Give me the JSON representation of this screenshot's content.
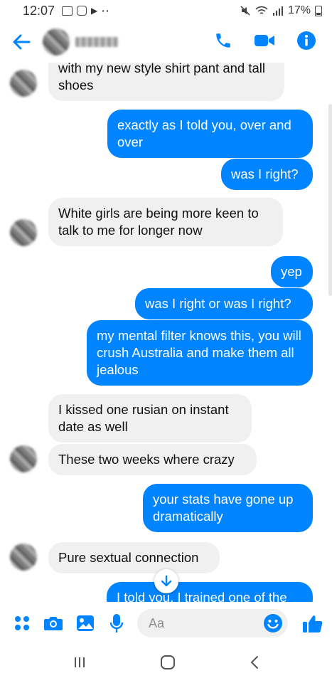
{
  "status_bar": {
    "time": "12:07",
    "battery": "17%"
  },
  "header": {
    "contact_name": ""
  },
  "messages": [
    {
      "dir": "in",
      "text": "with my new style shirt pant and tall shoes"
    },
    {
      "dir": "out",
      "text": "exactly as I told you, over and over"
    },
    {
      "dir": "out",
      "text": "was I right?"
    },
    {
      "dir": "in",
      "text": "White girls are being more keen to talk to me for longer now"
    },
    {
      "dir": "out",
      "text": "yep"
    },
    {
      "dir": "out",
      "text": "was I right or was I right?"
    },
    {
      "dir": "out",
      "text": "my mental filter knows this, you will crush Australia and make them all jealous"
    },
    {
      "dir": "in",
      "text": "I kissed one rusian on instant date as well"
    },
    {
      "dir": "in",
      "text": "These two weeks where crazy"
    },
    {
      "dir": "out",
      "text": "your stats have gone up dramatically"
    },
    {
      "dir": "in",
      "text": "Pure sextual connection"
    },
    {
      "dir": "out",
      "text": "I told you, I trained one of the"
    }
  ],
  "composer": {
    "placeholder": "Aa"
  },
  "colors": {
    "accent": "#0084ff",
    "incoming_bubble": "#f1f0f0",
    "outgoing_text": "#ffffff"
  }
}
